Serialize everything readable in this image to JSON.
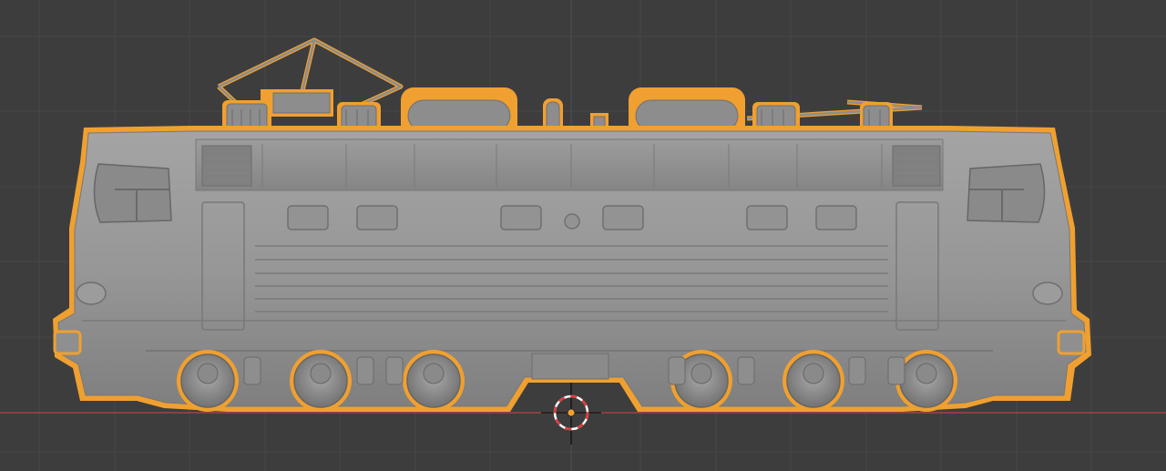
{
  "viewport": {
    "background_color": "#3d3d3d",
    "grid_color": "#474747",
    "x_axis_color": "#b8434a",
    "y_axis_color": "#6a8fd6",
    "selection_outline_color": "#f0a030",
    "mesh_color": "#8f8f8f"
  },
  "scene": {
    "object": "electric-locomotive-mesh",
    "selected": true
  },
  "cursor_3d": {
    "icon": "3d-cursor-icon",
    "center_color": "#f0a030",
    "ring_colors": [
      "#e23a3a",
      "#ffffff"
    ]
  }
}
